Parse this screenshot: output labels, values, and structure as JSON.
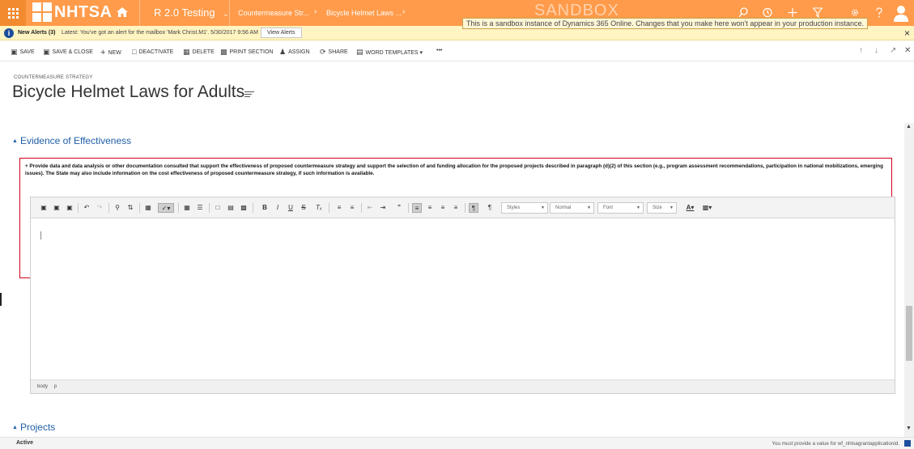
{
  "nav": {
    "logo_text": "NHTSA",
    "area": "R 2.0 Testing",
    "area_chevron": "⌄",
    "breadcrumbs": [
      "Countermeasure Str...",
      "Bicycle Helmet Laws ..."
    ],
    "breadcrumb_sep": "›",
    "sandbox_watermark": "SANDBOX",
    "sandbox_notice": "This is a sandbox instance of Dynamics 365 Online. Changes that you make here won't appear in your production instance.",
    "accent_color": "#ff9b4a"
  },
  "alerts": {
    "title": "New Alerts (3)",
    "message": "Latest: You've got an alert for the mailbox 'Mark Christ.M1'. 5/30/2017 9:56 AM",
    "view_button": "View Alerts",
    "close": "×"
  },
  "commands": {
    "save": "SAVE",
    "save_close": "SAVE & CLOSE",
    "new": "NEW",
    "deactivate": "DEACTIVATE",
    "delete": "DELETE",
    "print_section": "PRINT SECTION",
    "assign": "ASSIGN",
    "share": "SHARE",
    "word_templates": "WORD TEMPLATES ▾",
    "more": "•••"
  },
  "record": {
    "entity_type": "COUNTERMEASURE STRATEGY",
    "title": "Bicycle Helmet Laws for Adults"
  },
  "sections": {
    "evidence": {
      "title": "Evidence of Effectiveness",
      "instructions": "+ Provide data and data analysis or other documentation consulted that support the effectiveness of proposed countermeasure strategy and support the selection of and funding allocation for the proposed projects described in paragraph (d)(2) of this section (e.g., program assessment recommendations, participation in national mobilizations, emerging issues). The State may also include information on the cost effectiveness of proposed countermeasure strategy, if such information is available."
    },
    "projects": {
      "title": "Projects"
    }
  },
  "editor": {
    "combos": {
      "styles": "Styles",
      "format": "Normal",
      "font": "Font",
      "size": "Size"
    },
    "statusbar": [
      "body",
      "p"
    ]
  },
  "footer": {
    "status": "Active",
    "message": "You must provide a value for wf_nhtsagrantapplicationid."
  }
}
